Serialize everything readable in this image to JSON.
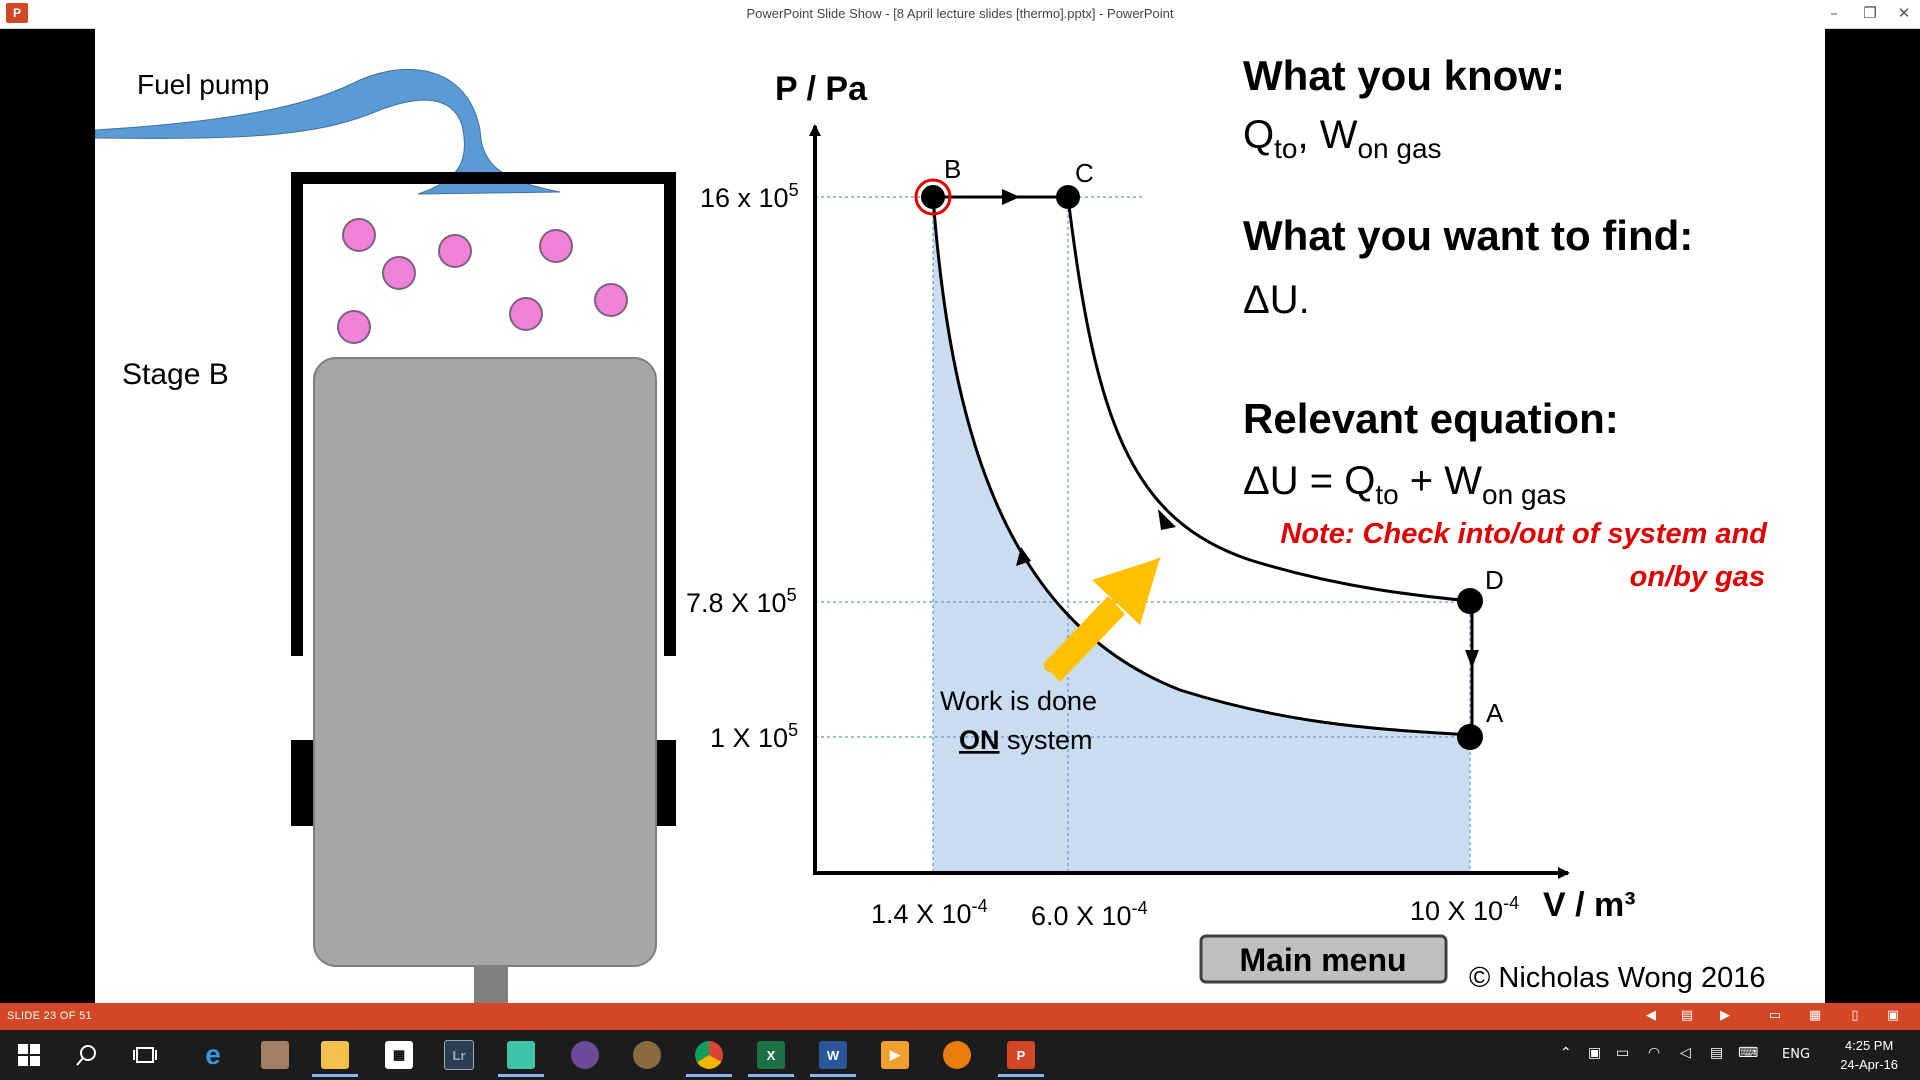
{
  "window": {
    "title": "PowerPoint Slide Show - [8 April lecture slides [thermo].pptx] - PowerPoint",
    "app_icon_label": "P"
  },
  "slide": {
    "fuel_pump_label": "Fuel pump",
    "stage_label": "Stage B",
    "pressure_axis_label": "P / Pa",
    "volume_axis_label": "V / m³",
    "pressure_ticks": [
      {
        "mantissa": "16 x 10",
        "exp": "5"
      },
      {
        "mantissa": "7.8 X 10",
        "exp": "5"
      },
      {
        "mantissa": "1 X 10",
        "exp": "5"
      }
    ],
    "volume_ticks": [
      {
        "mantissa": "1.4 X 10",
        "exp": "-4"
      },
      {
        "mantissa": "6.0 X 10",
        "exp": "-4"
      },
      {
        "mantissa": "10 X 10",
        "exp": "-4"
      }
    ],
    "points": [
      "A",
      "B",
      "C",
      "D"
    ],
    "work_label_line1": "Work is done",
    "work_label_bold": "ON",
    "work_label_rest": " system",
    "know_heading": "What you know:",
    "know_q": "Q",
    "know_q_sub": "to",
    "know_sep": ", W",
    "know_w_sub": "on gas",
    "find_heading": "What you want to find:",
    "find_value": "ΔU.",
    "equation_heading": "Relevant equation:",
    "eq_lhs": "ΔU = Q",
    "eq_sub1": "to",
    "eq_mid": " + W",
    "eq_sub2": "on  gas",
    "note_line1": "Note: Check into/out of system and",
    "note_line2": "on/by gas",
    "main_menu_label": "Main menu",
    "copyright": "© Nicholas Wong 2016",
    "colors": {
      "accent": "#d24726",
      "note": "#e00000",
      "molecule": "#ee82d6",
      "pump": "#5b9bd5",
      "piston": "#a6a6a6",
      "arrow": "#ffc000",
      "shade": "#c9dcf0"
    }
  },
  "statusbar": {
    "slide_counter": "SLIDE 23 OF 51"
  },
  "taskbar": {
    "apps": [
      {
        "name": "start-icon",
        "label": ""
      },
      {
        "name": "search-icon",
        "label": ""
      },
      {
        "name": "task-view-icon",
        "label": ""
      },
      {
        "name": "edge-icon",
        "label": "e"
      },
      {
        "name": "paint-icon",
        "label": ""
      },
      {
        "name": "file-explorer-icon",
        "label": ""
      },
      {
        "name": "store-icon",
        "label": ""
      },
      {
        "name": "lightroom-icon",
        "label": "Lr"
      },
      {
        "name": "photo-app-icon",
        "label": ""
      },
      {
        "name": "app-icon",
        "label": ""
      },
      {
        "name": "gimp-icon",
        "label": ""
      },
      {
        "name": "chrome-icon",
        "label": ""
      },
      {
        "name": "excel-icon",
        "label": "X"
      },
      {
        "name": "word-icon",
        "label": "W"
      },
      {
        "name": "media-player-icon",
        "label": ""
      },
      {
        "name": "blender-icon",
        "label": ""
      },
      {
        "name": "powerpoint-icon",
        "label": "P"
      }
    ],
    "language": "ENG",
    "time": "4:25 PM",
    "date": "24-Apr-16"
  }
}
